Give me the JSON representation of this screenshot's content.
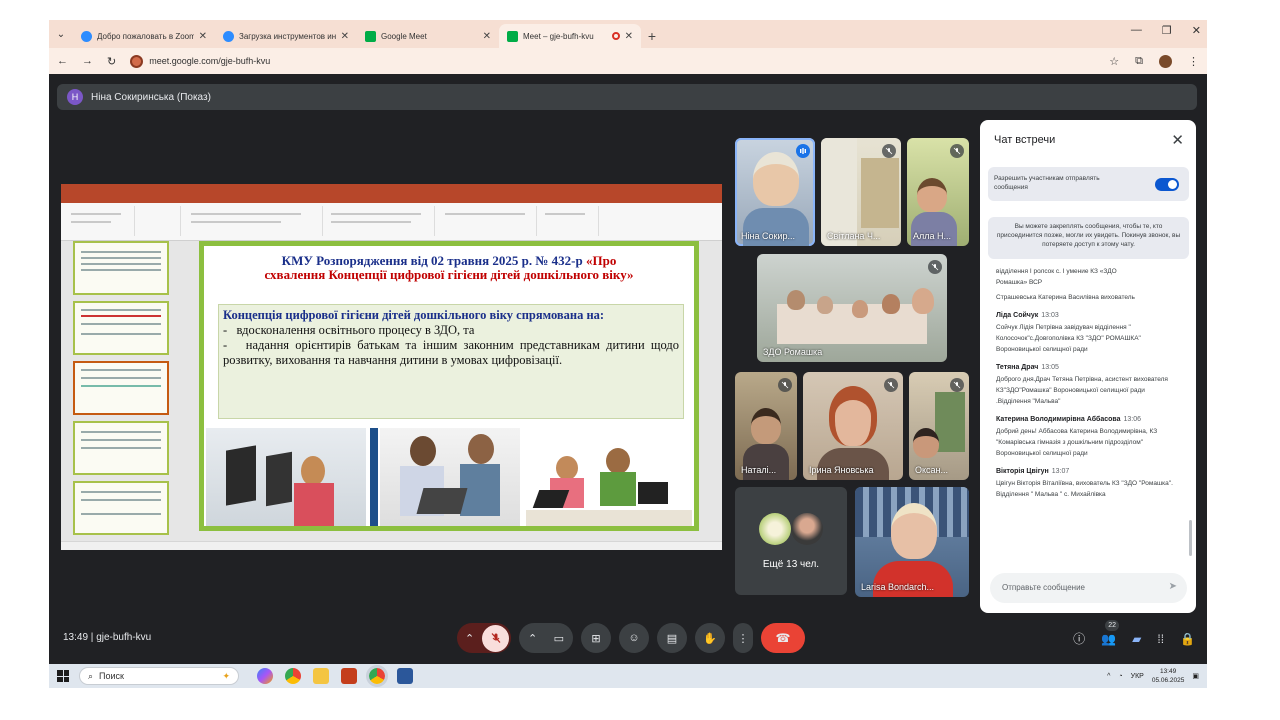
{
  "browser": {
    "tabs": [
      {
        "title": "Добро пожаловать в Zoom - Z",
        "icon": "zoom-icon",
        "color": "#2d8cff",
        "active": false
      },
      {
        "title": "Загрузка инструментов интег",
        "icon": "zoom-icon",
        "color": "#2d8cff",
        "active": false
      },
      {
        "title": "Google Meet",
        "icon": "meet-icon",
        "color": "#00ac47",
        "active": false
      },
      {
        "title": "Meet – gje-bufh-kvu",
        "icon": "meet-icon",
        "color": "#00ac47",
        "active": true
      }
    ],
    "url": "meet.google.com/gje-bufh-kvu"
  },
  "presenter": {
    "initial": "Н",
    "label": "Ніна Сокиринська (Показ)"
  },
  "slide": {
    "title_blue": "КМУ Розпорядження від 02 травня 2025 р. № 432-р",
    "title_red_1": "«Про",
    "title_red_2": "схвалення Концепції цифрової гігієни дітей дошкільного віку»",
    "box_heading": "Концепція цифрової гігієни дітей дошкільного віку спрямована на:",
    "bullet_1": "вдосконалення освітнього процесу в ЗДО, та",
    "bullet_2": "надання орієнтирів батькам та іншим законним представникам дитини щодо розвитку, виховання та навчання дитини в умовах цифровізації."
  },
  "participants": [
    {
      "name": "Ніна Сокир...",
      "muted": false,
      "speaking": true
    },
    {
      "name": "Світлана Ч...",
      "muted": true
    },
    {
      "name": "Алла Н...",
      "muted": true
    },
    {
      "name": "ЗДО Ромашка",
      "muted": true
    },
    {
      "name": "Наталі...",
      "muted": true
    },
    {
      "name": "Ірина Яновська",
      "muted": true
    },
    {
      "name": "Оксан...",
      "muted": true
    },
    {
      "name": "Larisa Bondarch...",
      "muted": true
    }
  ],
  "more_participants": "Ещё 13 чел.",
  "chat": {
    "title": "Чат встречи",
    "toggle_label": "Разрешить участникам отправлять сообщения",
    "info": "Вы можете закреплять сообщения, чтобы те, кто присоединится позже, могли их увидеть. Покинув звонок, вы потеряете доступ к этому чату.",
    "partial_1": "відділення І ролсок с. І умение КЗ «ЗДО",
    "partial_2": "Ромашка» ВСР",
    "partial_3": "Страшевська Катерина Василівна вихователь",
    "messages": [
      {
        "name": "Ліда Сойчук",
        "time": "13:03",
        "text": "Сойчук Лідія Петрівна завідувач відділення \" Колосочок\"с.Довгополівка КЗ \"ЗДО\" РОМАШКА\" Вороновицької селищної ради"
      },
      {
        "name": "Тетяна Драч",
        "time": "13:05",
        "text": "Доброго дня.Драч Тетяна Петрівна, асистент вихователя КЗ\"ЗДО\"Ромашка\" Вороновицької селищної ради .Відділення \"Мальва\""
      },
      {
        "name": "Катерина Володимирівна Аббасова",
        "time": "13:06",
        "text": "Добрий день! Аббасова Катерина Володимирівна, КЗ \"Комарівська гімназія з дошкільним підрозділом\" Вороновицької селищної ради"
      },
      {
        "name": "Вікторія Цвігун",
        "time": "13:07",
        "text": "Цвігун Вікторія Віталіївна, вихователь КЗ \"ЗДО \"Ромашка\". Відділення \" Мальва \" с. Михайлівка"
      }
    ],
    "input_placeholder": "Отправьте сообщение"
  },
  "meeting": {
    "time": "13:49",
    "code": "gje-bufh-kvu",
    "people_count": "22"
  },
  "taskbar": {
    "search": "Поиск",
    "lang": "УКР",
    "time": "13:49",
    "date": "05.06.2025"
  },
  "colors": {
    "end_call": "#ea4335",
    "accent": "#1a73e8",
    "slide_border": "#8cbf3f",
    "ppt_brand": "#b7472a"
  }
}
